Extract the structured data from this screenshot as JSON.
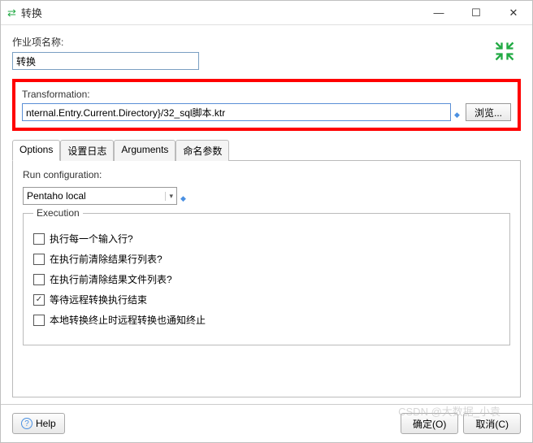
{
  "titlebar": {
    "title": "转换"
  },
  "jobname": {
    "label": "作业项名称:",
    "value": "转换"
  },
  "transformation": {
    "label": "Transformation:",
    "value": "nternal.Entry.Current.Directory}/32_sql脚本.ktr",
    "browse": "浏览..."
  },
  "tabs": {
    "items": [
      {
        "label": "Options"
      },
      {
        "label": "设置日志"
      },
      {
        "label": "Arguments"
      },
      {
        "label": "命名参数"
      }
    ]
  },
  "runconfig": {
    "label": "Run configuration:",
    "value": "Pentaho local"
  },
  "execution": {
    "legend": "Execution",
    "items": [
      {
        "label": "执行每一个输入行?",
        "checked": false
      },
      {
        "label": "在执行前清除结果行列表?",
        "checked": false
      },
      {
        "label": "在执行前清除结果文件列表?",
        "checked": false
      },
      {
        "label": "等待远程转换执行结束",
        "checked": true
      },
      {
        "label": "本地转换终止时远程转换也通知终止",
        "checked": false
      }
    ]
  },
  "footer": {
    "help": "Help",
    "ok": "确定(O)",
    "cancel": "取消(C)"
  },
  "watermark": "CSDN @大数据_小袁"
}
